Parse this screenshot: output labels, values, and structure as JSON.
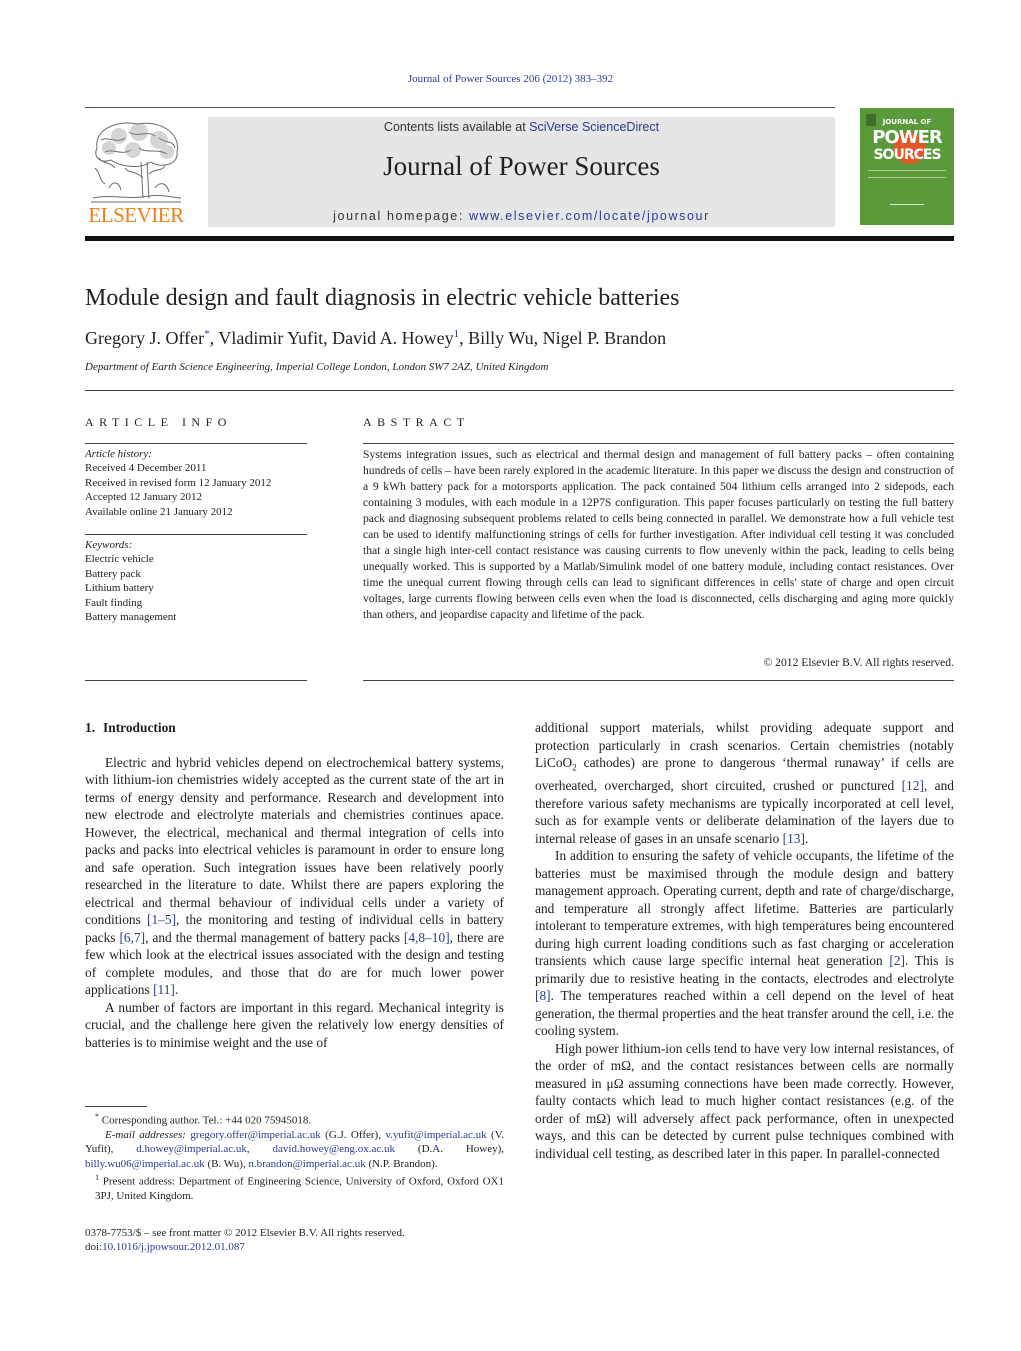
{
  "header": {
    "journal_ref": "Journal of Power Sources 206 (2012) 383–392",
    "contents_prefix": "Contents lists available at ",
    "contents_link": "SciVerse ScienceDirect",
    "journal_title": "Journal of Power Sources",
    "homepage_prefix": "journal homepage: ",
    "homepage_link": "www.elsevier.com/locate/jpowsour",
    "publisher_logo": "ELSEVIER",
    "cover": {
      "line1": "JOURNAL OF",
      "line2": "POWER",
      "line3": "SOURCES",
      "background": "#5b9a3b",
      "accent": "#e0582a"
    },
    "publisher_color": "#f07f18",
    "link_color": "#2b3a8f"
  },
  "article": {
    "title": "Module design and fault diagnosis in electric vehicle batteries",
    "authors": [
      {
        "name": "Gregory J. Offer",
        "mark": "*"
      },
      {
        "name": "Vladimir Yufit",
        "mark": ""
      },
      {
        "name": "David A. Howey",
        "mark": "1"
      },
      {
        "name": "Billy Wu",
        "mark": ""
      },
      {
        "name": "Nigel P. Brandon",
        "mark": ""
      }
    ],
    "affiliation": "Department of Earth Science Engineering, Imperial College London, London SW7 2AZ, United Kingdom"
  },
  "article_info": {
    "label": "ARTICLE INFO",
    "history_label": "Article history:",
    "history": [
      "Received 4 December 2011",
      "Received in revised form 12 January 2012",
      "Accepted 12 January 2012",
      "Available online 21 January 2012"
    ],
    "keywords_label": "Keywords:",
    "keywords": [
      "Electric vehicle",
      "Battery pack",
      "Lithium battery",
      "Fault finding",
      "Battery management"
    ]
  },
  "abstract": {
    "label": "ABSTRACT",
    "text": "Systems integration issues, such as electrical and thermal design and management of full battery packs – often containing hundreds of cells – have been rarely explored in the academic literature. In this paper we discuss the design and construction of a 9 kWh battery pack for a motorsports application. The pack contained 504 lithium cells arranged into 2 sidepods, each containing 3 modules, with each module in a 12P7S configuration. This paper focuses particularly on testing the full battery pack and diagnosing subsequent problems related to cells being connected in parallel. We demonstrate how a full vehicle test can be used to identify malfunctioning strings of cells for further investigation. After individual cell testing it was concluded that a single high inter-cell contact resistance was causing currents to flow unevenly within the pack, leading to cells being unequally worked. This is supported by a Matlab/Simulink model of one battery module, including contact resistances. Over time the unequal current flowing through cells can lead to significant differences in cells' state of charge and open circuit voltages, large currents flowing between cells even when the load is disconnected, cells discharging and aging more quickly than others, and jeopardise capacity and lifetime of the pack.",
    "copyright": "© 2012 Elsevier B.V. All rights reserved."
  },
  "body": {
    "section_number": "1.",
    "section_title": "Introduction",
    "left_paragraphs": [
      [
        {
          "t": "Electric and hybrid vehicles depend on electrochemical battery systems, with lithium-ion chemistries widely accepted as the current state of the art in terms of energy density and performance. Research and development into new electrode and electrolyte materials and chemistries continues apace. However, the electrical, mechanical and thermal integration of cells into packs and packs into electrical vehicles is paramount in order to ensure long and safe operation. Such integration issues have been relatively poorly researched in the literature to date. Whilst there are papers exploring the electrical and thermal behaviour of individual cells under a variety of conditions "
        },
        {
          "ref": "[1–5]"
        },
        {
          "t": ", the monitoring and testing of individual cells in battery packs "
        },
        {
          "ref": "[6,7]"
        },
        {
          "t": ", and the thermal management of battery packs "
        },
        {
          "ref": "[4,8–10]"
        },
        {
          "t": ", there are few which look at the electrical issues associated with the design and testing of complete modules, and those that do are for much lower power applications "
        },
        {
          "ref": "[11]"
        },
        {
          "t": "."
        }
      ],
      [
        {
          "t": "A number of factors are important in this regard. Mechanical integrity is crucial, and the challenge here given the relatively low energy densities of batteries is to minimise weight and the use of"
        }
      ]
    ],
    "right_paragraphs": [
      [
        {
          "t": "additional support materials, whilst providing adequate support and protection particularly in crash scenarios. Certain chemistries (notably LiCoO"
        },
        {
          "sub": "2"
        },
        {
          "t": " cathodes) are prone to dangerous ‘thermal runaway’ if cells are overheated, overcharged, short circuited, crushed or punctured "
        },
        {
          "ref": "[12]"
        },
        {
          "t": ", and therefore various safety mechanisms are typically incorporated at cell level, such as for example vents or deliberate delamination of the layers due to internal release of gases in an unsafe scenario "
        },
        {
          "ref": "[13]"
        },
        {
          "t": "."
        }
      ],
      [
        {
          "t": "In addition to ensuring the safety of vehicle occupants, the lifetime of the batteries must be maximised through the module design and battery management approach. Operating current, depth and rate of charge/discharge, and temperature all strongly affect lifetime. Batteries are particularly intolerant to temperature extremes, with high temperatures being encountered during high current loading conditions such as fast charging or acceleration transients which cause large specific internal heat generation "
        },
        {
          "ref": "[2]"
        },
        {
          "t": ". This is primarily due to resistive heating in the contacts, electrodes and electrolyte "
        },
        {
          "ref": "[8]"
        },
        {
          "t": ". The temperatures reached within a cell depend on the level of heat generation, the thermal properties and the heat transfer around the cell, i.e. the cooling system."
        }
      ],
      [
        {
          "t": "High power lithium-ion cells tend to have very low internal resistances, of the order of mΩ, and the contact resistances between cells are normally measured in μΩ assuming connections have been made correctly. However, faulty contacts which lead to much higher contact resistances (e.g. of the order of mΩ) will adversely affect pack performance, often in unexpected ways, and this can be detected by current pulse techniques combined with individual cell testing, as described later in this paper. In parallel-connected"
        }
      ]
    ]
  },
  "footnotes": {
    "corresponding": "Corresponding author. Tel.: +44 020 75945018.",
    "corresponding_mark": "*",
    "email_label": "E-mail addresses:",
    "emails": [
      {
        "email": "gregory.offer@imperial.ac.uk",
        "who": "(G.J. Offer),"
      },
      {
        "email": "v.yufit@imperial.ac.uk",
        "who": "(V. Yufit),"
      },
      {
        "email": "d.howey@imperial.ac.uk",
        "who": ","
      },
      {
        "email": "david.howey@eng.ox.ac.uk",
        "who": "(D.A. Howey),"
      },
      {
        "email": "billy.wu06@imperial.ac.uk",
        "who": "(B. Wu),"
      },
      {
        "email": "n.brandon@imperial.ac.uk",
        "who": "(N.P. Brandon)."
      }
    ],
    "present_address_mark": "1",
    "present_address": "Present address: Department of Engineering Science, University of Oxford, Oxford OX1 3PJ, United Kingdom."
  },
  "front_matter": {
    "issn_line": "0378-7753/$ – see front matter © 2012 Elsevier B.V. All rights reserved.",
    "doi_prefix": "doi:",
    "doi": "10.1016/j.jpowsour.2012.01.087"
  }
}
